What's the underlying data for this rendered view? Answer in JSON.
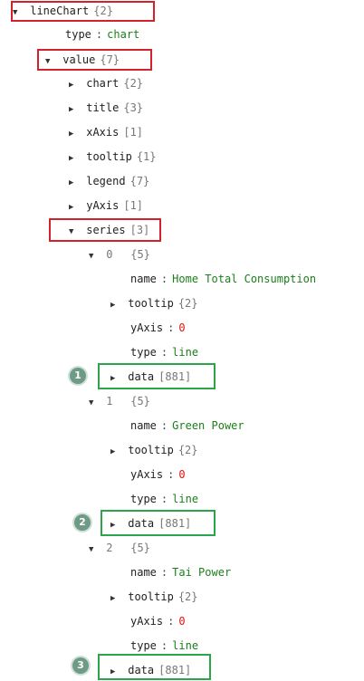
{
  "tree": {
    "root": {
      "key": "lineChart",
      "count": "{2}"
    },
    "type_row": {
      "key": "type",
      "value": "chart"
    },
    "value_row": {
      "key": "value",
      "count": "{7}"
    },
    "value_children": [
      {
        "key": "chart",
        "count": "{2}"
      },
      {
        "key": "title",
        "count": "{3}"
      },
      {
        "key": "xAxis",
        "count": "[1]"
      },
      {
        "key": "tooltip",
        "count": "{1}"
      },
      {
        "key": "legend",
        "count": "{7}"
      },
      {
        "key": "yAxis",
        "count": "[1]"
      }
    ],
    "series_row": {
      "key": "series",
      "count": "[3]"
    },
    "series_items": [
      {
        "index": "0",
        "count": "{5}",
        "name": "Home Total Consumption",
        "tooltip_count": "{2}",
        "yAxis": "0",
        "type": "line",
        "data_count": "[881]"
      },
      {
        "index": "1",
        "count": "{5}",
        "name": "Green Power",
        "tooltip_count": "{2}",
        "yAxis": "0",
        "type": "line",
        "data_count": "[881]"
      },
      {
        "index": "2",
        "count": "{5}",
        "name": "Tai Power",
        "tooltip_count": "{2}",
        "yAxis": "0",
        "type": "line",
        "data_count": "[881]"
      }
    ],
    "labels": {
      "name": "name",
      "tooltip": "tooltip",
      "yAxis": "yAxis",
      "type": "type",
      "data": "data",
      "colon": ":"
    }
  },
  "badges": [
    "1",
    "2",
    "3"
  ],
  "colors": {
    "red_box": "#d3222a",
    "green_box": "#2aa54a",
    "string": "#1a7f1a",
    "number": "#d11",
    "badge": "#6f9b86"
  }
}
